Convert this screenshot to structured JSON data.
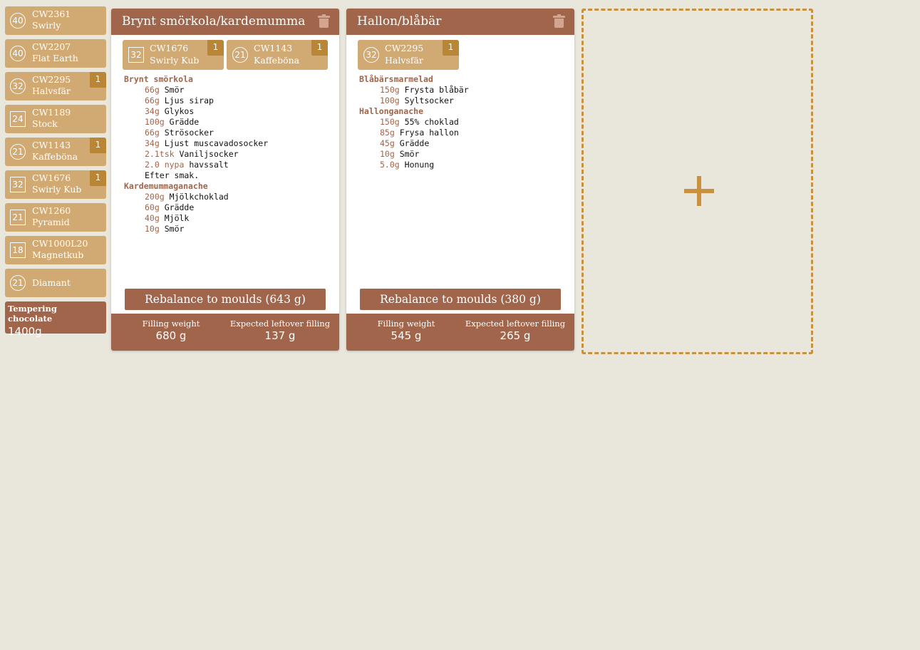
{
  "sidebar": {
    "moulds": [
      {
        "count": "40",
        "shape": "circle",
        "code": "CW2361",
        "name": "Swirly",
        "badge": ""
      },
      {
        "count": "40",
        "shape": "circle",
        "code": "CW2207",
        "name": "Flat Earth",
        "badge": ""
      },
      {
        "count": "32",
        "shape": "circle",
        "code": "CW2295",
        "name": "Halvsfär",
        "badge": "1"
      },
      {
        "count": "24",
        "shape": "square",
        "code": "CW1189",
        "name": "Stock",
        "badge": ""
      },
      {
        "count": "21",
        "shape": "circle",
        "code": "CW1143",
        "name": "Kaffeböna",
        "badge": "1"
      },
      {
        "count": "32",
        "shape": "square",
        "code": "CW1676",
        "name": "Swirly Kub",
        "badge": "1"
      },
      {
        "count": "21",
        "shape": "square",
        "code": "CW1260",
        "name": "Pyramid",
        "badge": ""
      },
      {
        "count": "18",
        "shape": "square",
        "code": "CW1000L20",
        "name": "Magnetkub",
        "badge": ""
      },
      {
        "count": "21",
        "shape": "circle",
        "code": "",
        "name": "Diamant",
        "badge": ""
      }
    ],
    "tempering": {
      "label": "Tempering chocolate",
      "value": "1400g"
    }
  },
  "cards": [
    {
      "title": "Brynt smörkola/kardemumma",
      "chips": [
        {
          "count": "32",
          "shape": "square",
          "code": "CW1676",
          "name": "Swirly Kub",
          "badge": "1"
        },
        {
          "count": "21",
          "shape": "circle",
          "code": "CW1143",
          "name": "Kaffeböna",
          "badge": "1"
        }
      ],
      "sections": [
        {
          "name": "Brynt smörkola",
          "lines": [
            {
              "amount": "66g",
              "item": "Smör"
            },
            {
              "amount": "66g",
              "item": "Ljus sirap"
            },
            {
              "amount": "34g",
              "item": "Glykos"
            },
            {
              "amount": "100g",
              "item": "Grädde"
            },
            {
              "amount": "66g",
              "item": "Strösocker"
            },
            {
              "amount": "34g",
              "item": "Ljust muscavadosocker"
            },
            {
              "amount": "2.1tsk",
              "item": "Vaniljsocker"
            },
            {
              "amount": "2.0 nypa",
              "item": "havssalt"
            },
            {
              "amount": "",
              "item": "Efter smak."
            }
          ]
        },
        {
          "name": "Kardemummaganache",
          "lines": [
            {
              "amount": "200g",
              "item": "Mjölkchoklad"
            },
            {
              "amount": "60g",
              "item": "Grädde"
            },
            {
              "amount": "40g",
              "item": "Mjölk"
            },
            {
              "amount": "10g",
              "item": "Smör"
            }
          ]
        }
      ],
      "rebalance_label": "Rebalance to moulds (643 g)",
      "filling_weight_label": "Filling weight",
      "filling_weight": "680 g",
      "leftover_label": "Expected leftover filling",
      "leftover": "137 g"
    },
    {
      "title": "Hallon/blåbär",
      "chips": [
        {
          "count": "32",
          "shape": "circle",
          "code": "CW2295",
          "name": "Halvsfär",
          "badge": "1"
        }
      ],
      "sections": [
        {
          "name": "Blåbärsmarmelad",
          "lines": [
            {
              "amount": "150g",
              "item": "Frysta blåbär"
            },
            {
              "amount": "100g",
              "item": "Syltsocker"
            }
          ]
        },
        {
          "name": "Hallonganache",
          "lines": [
            {
              "amount": "150g",
              "item": "55% choklad"
            },
            {
              "amount": "85g",
              "item": "Frysa hallon"
            },
            {
              "amount": "45g",
              "item": "Grädde"
            },
            {
              "amount": "10g",
              "item": "Smör"
            },
            {
              "amount": "5.0g",
              "item": "Honung"
            }
          ]
        }
      ],
      "rebalance_label": "Rebalance to moulds (380 g)",
      "filling_weight_label": "Filling weight",
      "filling_weight": "545 g",
      "leftover_label": "Expected leftover filling",
      "leftover": "265 g"
    }
  ],
  "add_slot": {
    "icon": "plus-icon"
  },
  "colors": {
    "background": "#e9e6dc",
    "mould": "#d1a972",
    "badge": "#b98536",
    "accent": "#a0654a",
    "dashed": "#c9903d"
  }
}
